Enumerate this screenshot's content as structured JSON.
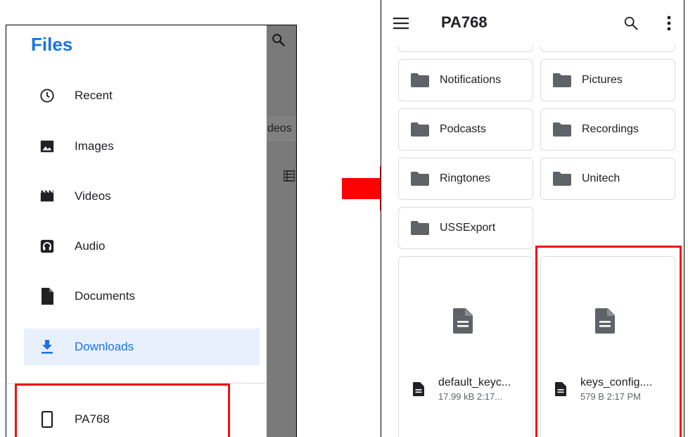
{
  "left_screen": {
    "drawer_title": "Files",
    "nav_items": [
      {
        "label": "Recent",
        "icon": "clock-icon"
      },
      {
        "label": "Images",
        "icon": "image-icon"
      },
      {
        "label": "Videos",
        "icon": "video-icon"
      },
      {
        "label": "Audio",
        "icon": "audio-icon"
      },
      {
        "label": "Documents",
        "icon": "document-icon"
      },
      {
        "label": "Downloads",
        "icon": "download-icon",
        "selected": true
      }
    ],
    "device_item": {
      "label": "PA768",
      "icon": "phone-icon"
    },
    "background_peek": {
      "chip_text": "deos"
    }
  },
  "right_screen": {
    "title": "PA768",
    "folders": [
      {
        "name": "Notifications"
      },
      {
        "name": "Pictures"
      },
      {
        "name": "Podcasts"
      },
      {
        "name": "Recordings"
      },
      {
        "name": "Ringtones"
      },
      {
        "name": "Unitech"
      },
      {
        "name": "USSExport"
      }
    ],
    "files": [
      {
        "name": "default_keyc...",
        "meta": "17.99 kB 2:17..."
      },
      {
        "name": "keys_config....",
        "meta": "579 B 2:17 PM"
      }
    ]
  },
  "colors": {
    "accent": "#1a73e8",
    "selected_bg": "#e8f0fe",
    "highlight_red": "#ee1111",
    "arrow_red": "#ff0000",
    "scrim": "#7a7a7a"
  }
}
